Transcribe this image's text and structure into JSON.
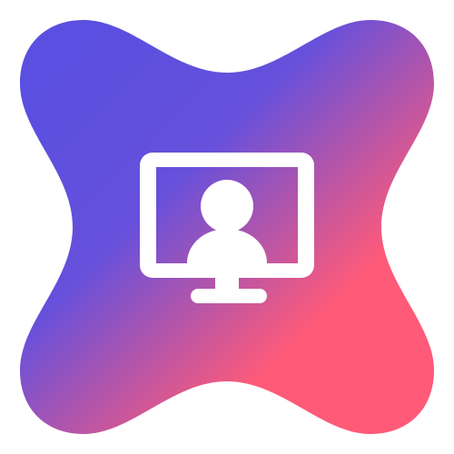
{
  "icon": {
    "name": "monitor-user-icon",
    "shape": "four-point-rounded-star",
    "colors": {
      "gradient_start": "#5a4fe0",
      "gradient_mid": "#6650dc",
      "gradient_end": "#ff5a78",
      "glyph": "#ffffff",
      "background": "#ffffff"
    }
  }
}
